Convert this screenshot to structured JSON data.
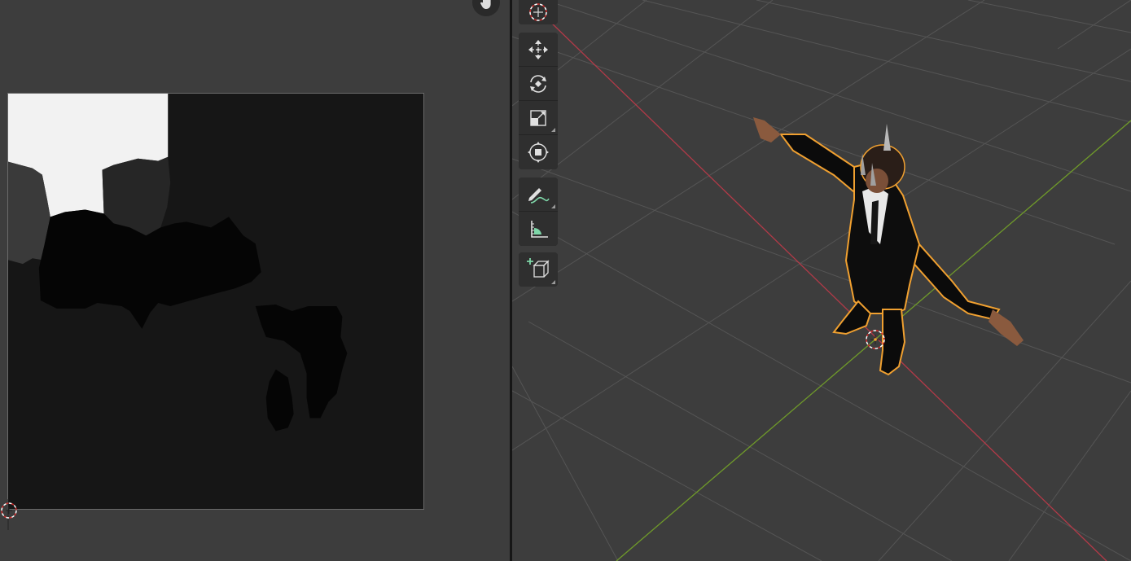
{
  "colors": {
    "editor_bg": "#3d3d3d",
    "viewport_bg": "#3d3d3d",
    "texture_dark": "#141414",
    "texture_white": "#f2f2f2",
    "grid_line": "#555555",
    "x_axis": "#b33a48",
    "y_axis": "#6f9a2a",
    "selection_outline": "#f0a030",
    "tool_bg": "#2f2f2f",
    "accent_green": "#7ed6a8"
  },
  "image_editor": {
    "hand_icon": "hand-pan-icon",
    "cursor_icon": "2d-cursor-icon"
  },
  "toolbar": {
    "tools": [
      {
        "name": "cursor",
        "icon": "cursor-crosshair-icon"
      },
      {
        "name": "move",
        "icon": "move-arrows-icon"
      },
      {
        "name": "rotate",
        "icon": "rotate-icon"
      },
      {
        "name": "scale",
        "icon": "scale-icon"
      },
      {
        "name": "transform",
        "icon": "transform-icon"
      },
      {
        "name": "annotate",
        "icon": "annotate-pencil-icon"
      },
      {
        "name": "measure",
        "icon": "measure-ruler-icon"
      },
      {
        "name": "add-cube",
        "icon": "add-cube-icon"
      }
    ]
  }
}
